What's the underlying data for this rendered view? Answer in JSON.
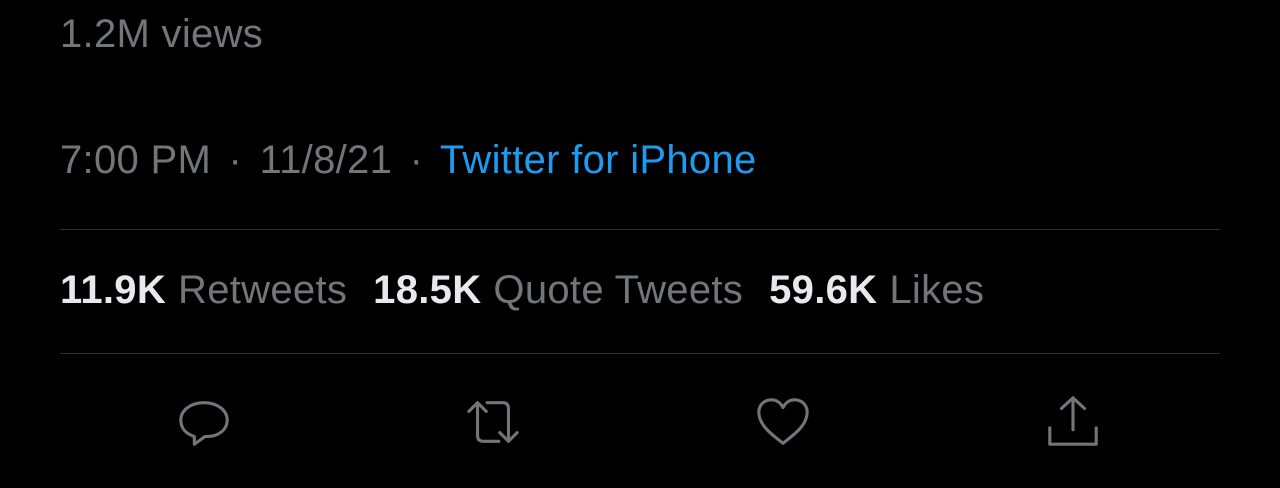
{
  "tweet": {
    "views": "1.2M views",
    "time": "7:00 PM",
    "separator": "·",
    "date": "11/8/21",
    "source": "Twitter for iPhone"
  },
  "stats": [
    {
      "count": "11.9K",
      "label": "Retweets"
    },
    {
      "count": "18.5K",
      "label": "Quote Tweets"
    },
    {
      "count": "59.6K",
      "label": "Likes"
    }
  ],
  "actions": [
    {
      "icon": "reply-icon"
    },
    {
      "icon": "retweet-icon"
    },
    {
      "icon": "like-icon"
    },
    {
      "icon": "share-icon"
    }
  ],
  "colors": {
    "background": "#000000",
    "text_primary": "#e7e9ea",
    "text_secondary": "#71767b",
    "link": "#1d9bf0",
    "divider": "#2f3336"
  }
}
